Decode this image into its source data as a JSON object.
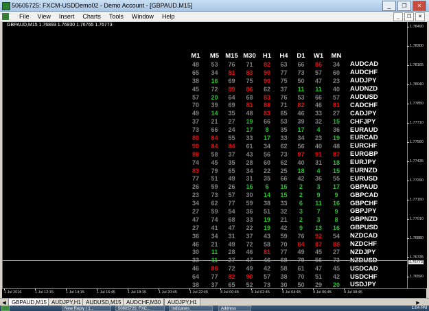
{
  "window": {
    "title": "50605725: FXCM-USDDemo02 - Demo Account - [GBPAUD,M15]"
  },
  "menu": [
    "File",
    "View",
    "Insert",
    "Charts",
    "Tools",
    "Window",
    "Help"
  ],
  "window_buttons": [
    "_",
    "❐",
    "✕"
  ],
  "chart": {
    "caption": "GBPAUD,M15  1.76893 1.76930 1.76765 1.76773",
    "y_ticks": [
      "1.78490",
      "1.78300",
      "1.78165",
      "1.78040",
      "1.77850",
      "1.77710",
      "1.77560",
      "1.77435",
      "1.77290",
      "1.77150",
      "1.77010",
      "1.76880",
      "1.76735",
      "1.76590"
    ],
    "current_price": "1.76773",
    "x_ticks": [
      "1 Jul 2016",
      "1 Jul 12:15",
      "1 Jul 14:15",
      "1 Jul 16:45",
      "1 Jul 18:15",
      "1 Jul 20:45",
      "1 Jul 22:45",
      "4 Jul 00:45",
      "4 Jul 02:45",
      "4 Jul 04:45",
      "4 Jul 06:45",
      "4 Jul 08:45"
    ]
  },
  "matrix": {
    "headers": [
      "M1",
      "M5",
      "M15",
      "M30",
      "H1",
      "H4",
      "D1",
      "W1",
      "MN"
    ],
    "colors": {
      "neutral": "#808080",
      "buy": "#22c22b",
      "sell": "#e01010",
      "label": "#ffffff"
    },
    "rows": [
      {
        "pair": "AUDCAD",
        "cells": [
          [
            "48",
            "n"
          ],
          [
            "53",
            "n"
          ],
          [
            "76",
            "n"
          ],
          [
            "71",
            "n"
          ],
          [
            "82",
            "s"
          ],
          [
            "63",
            "n"
          ],
          [
            "66",
            "n"
          ],
          [
            "86",
            "s"
          ],
          [
            "34",
            "n"
          ]
        ]
      },
      {
        "pair": "AUDCHF",
        "cells": [
          [
            "65",
            "n"
          ],
          [
            "34",
            "n"
          ],
          [
            "81",
            "s"
          ],
          [
            "83",
            "s"
          ],
          [
            "90",
            "s"
          ],
          [
            "77",
            "n"
          ],
          [
            "73",
            "n"
          ],
          [
            "57",
            "n"
          ],
          [
            "60",
            "n"
          ]
        ]
      },
      {
        "pair": "AUDJPY",
        "cells": [
          [
            "38",
            "n"
          ],
          [
            "16",
            "b"
          ],
          [
            "69",
            "n"
          ],
          [
            "75",
            "n"
          ],
          [
            "90",
            "s"
          ],
          [
            "75",
            "n"
          ],
          [
            "50",
            "n"
          ],
          [
            "47",
            "n"
          ],
          [
            "23",
            "n"
          ]
        ]
      },
      {
        "pair": "AUDNZD",
        "cells": [
          [
            "45",
            "n"
          ],
          [
            "72",
            "n"
          ],
          [
            "89",
            "s"
          ],
          [
            "86",
            "s"
          ],
          [
            "62",
            "n"
          ],
          [
            "37",
            "n"
          ],
          [
            "11",
            "b"
          ],
          [
            "11",
            "b"
          ],
          [
            "40",
            "n"
          ]
        ]
      },
      {
        "pair": "AUDUSD",
        "cells": [
          [
            "57",
            "n"
          ],
          [
            "20",
            "b"
          ],
          [
            "64",
            "n"
          ],
          [
            "68",
            "n"
          ],
          [
            "83",
            "s"
          ],
          [
            "76",
            "n"
          ],
          [
            "53",
            "n"
          ],
          [
            "66",
            "n"
          ],
          [
            "57",
            "n"
          ]
        ]
      },
      {
        "pair": "CADCHF",
        "cells": [
          [
            "70",
            "n"
          ],
          [
            "39",
            "n"
          ],
          [
            "69",
            "n"
          ],
          [
            "81",
            "s"
          ],
          [
            "86",
            "s"
          ],
          [
            "71",
            "n"
          ],
          [
            "82",
            "s"
          ],
          [
            "46",
            "n"
          ],
          [
            "81",
            "s"
          ]
        ]
      },
      {
        "pair": "CADJPY",
        "cells": [
          [
            "49",
            "n"
          ],
          [
            "14",
            "b"
          ],
          [
            "35",
            "n"
          ],
          [
            "48",
            "n"
          ],
          [
            "83",
            "s"
          ],
          [
            "65",
            "n"
          ],
          [
            "46",
            "n"
          ],
          [
            "33",
            "n"
          ],
          [
            "27",
            "n"
          ]
        ]
      },
      {
        "pair": "CHFJPY",
        "cells": [
          [
            "37",
            "n"
          ],
          [
            "21",
            "n"
          ],
          [
            "27",
            "n"
          ],
          [
            "19",
            "b"
          ],
          [
            "66",
            "n"
          ],
          [
            "53",
            "n"
          ],
          [
            "39",
            "n"
          ],
          [
            "32",
            "n"
          ],
          [
            "15",
            "b"
          ]
        ]
      },
      {
        "pair": "EURAUD",
        "cells": [
          [
            "73",
            "n"
          ],
          [
            "66",
            "n"
          ],
          [
            "24",
            "n"
          ],
          [
            "17",
            "b"
          ],
          [
            "8",
            "b"
          ],
          [
            "35",
            "n"
          ],
          [
            "17",
            "b"
          ],
          [
            "4",
            "b"
          ],
          [
            "36",
            "n"
          ]
        ]
      },
      {
        "pair": "EURCAD",
        "cells": [
          [
            "80",
            "s"
          ],
          [
            "84",
            "s"
          ],
          [
            "55",
            "n"
          ],
          [
            "33",
            "n"
          ],
          [
            "17",
            "b"
          ],
          [
            "33",
            "n"
          ],
          [
            "34",
            "n"
          ],
          [
            "23",
            "n"
          ],
          [
            "19",
            "b"
          ]
        ]
      },
      {
        "pair": "EURCHF",
        "cells": [
          [
            "90",
            "s"
          ],
          [
            "84",
            "s"
          ],
          [
            "84",
            "s"
          ],
          [
            "61",
            "n"
          ],
          [
            "34",
            "n"
          ],
          [
            "62",
            "n"
          ],
          [
            "56",
            "n"
          ],
          [
            "40",
            "n"
          ],
          [
            "48",
            "n"
          ]
        ]
      },
      {
        "pair": "EURGBP",
        "cells": [
          [
            "86",
            "s"
          ],
          [
            "58",
            "n"
          ],
          [
            "37",
            "n"
          ],
          [
            "43",
            "n"
          ],
          [
            "56",
            "n"
          ],
          [
            "73",
            "n"
          ],
          [
            "97",
            "s"
          ],
          [
            "91",
            "s"
          ],
          [
            "87",
            "s"
          ]
        ]
      },
      {
        "pair": "EURJPY",
        "cells": [
          [
            "74",
            "n"
          ],
          [
            "45",
            "n"
          ],
          [
            "35",
            "n"
          ],
          [
            "28",
            "n"
          ],
          [
            "60",
            "n"
          ],
          [
            "62",
            "n"
          ],
          [
            "40",
            "n"
          ],
          [
            "31",
            "n"
          ],
          [
            "18",
            "b"
          ]
        ]
      },
      {
        "pair": "EURNZD",
        "cells": [
          [
            "83",
            "s"
          ],
          [
            "79",
            "n"
          ],
          [
            "65",
            "n"
          ],
          [
            "34",
            "n"
          ],
          [
            "22",
            "n"
          ],
          [
            "25",
            "n"
          ],
          [
            "18",
            "b"
          ],
          [
            "4",
            "b"
          ],
          [
            "15",
            "b"
          ]
        ]
      },
      {
        "pair": "EURUSD",
        "cells": [
          [
            "77",
            "n"
          ],
          [
            "51",
            "n"
          ],
          [
            "49",
            "n"
          ],
          [
            "31",
            "n"
          ],
          [
            "35",
            "n"
          ],
          [
            "66",
            "n"
          ],
          [
            "42",
            "n"
          ],
          [
            "36",
            "n"
          ],
          [
            "55",
            "n"
          ]
        ]
      },
      {
        "pair": "GBPAUD",
        "cells": [
          [
            "26",
            "n"
          ],
          [
            "59",
            "n"
          ],
          [
            "26",
            "n"
          ],
          [
            "16",
            "b"
          ],
          [
            "6",
            "b"
          ],
          [
            "16",
            "b"
          ],
          [
            "2",
            "b"
          ],
          [
            "3",
            "b"
          ],
          [
            "17",
            "b"
          ]
        ]
      },
      {
        "pair": "GBPCAD",
        "cells": [
          [
            "23",
            "n"
          ],
          [
            "73",
            "n"
          ],
          [
            "57",
            "n"
          ],
          [
            "30",
            "n"
          ],
          [
            "14",
            "b"
          ],
          [
            "15",
            "b"
          ],
          [
            "2",
            "b"
          ],
          [
            "9",
            "b"
          ],
          [
            "9",
            "b"
          ]
        ]
      },
      {
        "pair": "GBPCHF",
        "cells": [
          [
            "34",
            "n"
          ],
          [
            "62",
            "n"
          ],
          [
            "77",
            "n"
          ],
          [
            "59",
            "n"
          ],
          [
            "38",
            "n"
          ],
          [
            "33",
            "n"
          ],
          [
            "6",
            "b"
          ],
          [
            "11",
            "b"
          ],
          [
            "16",
            "b"
          ]
        ]
      },
      {
        "pair": "GBPJPY",
        "cells": [
          [
            "27",
            "n"
          ],
          [
            "59",
            "n"
          ],
          [
            "54",
            "n"
          ],
          [
            "36",
            "n"
          ],
          [
            "51",
            "n"
          ],
          [
            "32",
            "n"
          ],
          [
            "3",
            "b"
          ],
          [
            "7",
            "b"
          ],
          [
            "9",
            "b"
          ]
        ]
      },
      {
        "pair": "GBPNZD",
        "cells": [
          [
            "47",
            "n"
          ],
          [
            "74",
            "n"
          ],
          [
            "68",
            "n"
          ],
          [
            "33",
            "n"
          ],
          [
            "19",
            "b"
          ],
          [
            "21",
            "n"
          ],
          [
            "2",
            "b"
          ],
          [
            "3",
            "b"
          ],
          [
            "8",
            "b"
          ]
        ]
      },
      {
        "pair": "GBPUSD",
        "cells": [
          [
            "27",
            "n"
          ],
          [
            "41",
            "n"
          ],
          [
            "47",
            "n"
          ],
          [
            "22",
            "n"
          ],
          [
            "19",
            "b"
          ],
          [
            "42",
            "n"
          ],
          [
            "9",
            "b"
          ],
          [
            "13",
            "b"
          ],
          [
            "16",
            "b"
          ]
        ]
      },
      {
        "pair": "NZDCAD",
        "cells": [
          [
            "36",
            "n"
          ],
          [
            "34",
            "n"
          ],
          [
            "31",
            "n"
          ],
          [
            "37",
            "n"
          ],
          [
            "43",
            "n"
          ],
          [
            "59",
            "n"
          ],
          [
            "76",
            "n"
          ],
          [
            "92",
            "s"
          ],
          [
            "54",
            "n"
          ]
        ]
      },
      {
        "pair": "NZDCHF",
        "cells": [
          [
            "46",
            "n"
          ],
          [
            "21",
            "n"
          ],
          [
            "49",
            "n"
          ],
          [
            "72",
            "n"
          ],
          [
            "58",
            "n"
          ],
          [
            "70",
            "n"
          ],
          [
            "84",
            "s"
          ],
          [
            "87",
            "s"
          ],
          [
            "88",
            "s"
          ]
        ]
      },
      {
        "pair": "NZDJPY",
        "cells": [
          [
            "30",
            "n"
          ],
          [
            "11",
            "b"
          ],
          [
            "28",
            "n"
          ],
          [
            "46",
            "n"
          ],
          [
            "81",
            "s"
          ],
          [
            "77",
            "n"
          ],
          [
            "49",
            "n"
          ],
          [
            "45",
            "n"
          ],
          [
            "27",
            "n"
          ]
        ]
      },
      {
        "pair": "NZDUSD",
        "cells": [
          [
            "33",
            "n"
          ],
          [
            "11",
            "b"
          ],
          [
            "27",
            "n"
          ],
          [
            "47",
            "n"
          ],
          [
            "46",
            "n"
          ],
          [
            "68",
            "n"
          ],
          [
            "79",
            "n"
          ],
          [
            "56",
            "n"
          ],
          [
            "73",
            "n"
          ]
        ]
      },
      {
        "pair": "USDCAD",
        "cells": [
          [
            "46",
            "n"
          ],
          [
            "86",
            "s"
          ],
          [
            "72",
            "n"
          ],
          [
            "49",
            "n"
          ],
          [
            "42",
            "n"
          ],
          [
            "58",
            "n"
          ],
          [
            "61",
            "n"
          ],
          [
            "47",
            "n"
          ],
          [
            "45",
            "n"
          ]
        ]
      },
      {
        "pair": "USDCHF",
        "cells": [
          [
            "64",
            "n"
          ],
          [
            "77",
            "n"
          ],
          [
            "82",
            "s"
          ],
          [
            "90",
            "s"
          ],
          [
            "57",
            "n"
          ],
          [
            "38",
            "n"
          ],
          [
            "70",
            "n"
          ],
          [
            "51",
            "n"
          ],
          [
            "42",
            "n"
          ]
        ]
      },
      {
        "pair": "USDJPY",
        "cells": [
          [
            "38",
            "n"
          ],
          [
            "37",
            "n"
          ],
          [
            "65",
            "n"
          ],
          [
            "52",
            "n"
          ],
          [
            "73",
            "n"
          ],
          [
            "30",
            "n"
          ],
          [
            "50",
            "n"
          ],
          [
            "29",
            "n"
          ],
          [
            "20",
            "b"
          ]
        ]
      }
    ]
  },
  "tabs": [
    "GBPAUD,M15",
    "AUDJPY,H1",
    "AUDUSD,M15",
    "AUDCHF,M30",
    "AUDJPY,H1"
  ],
  "taskbar": {
    "items": [
      "New Reply ( 1...",
      "50605725: FXC...",
      "Indicators",
      "Address"
    ],
    "clock": "1:04 PM"
  }
}
